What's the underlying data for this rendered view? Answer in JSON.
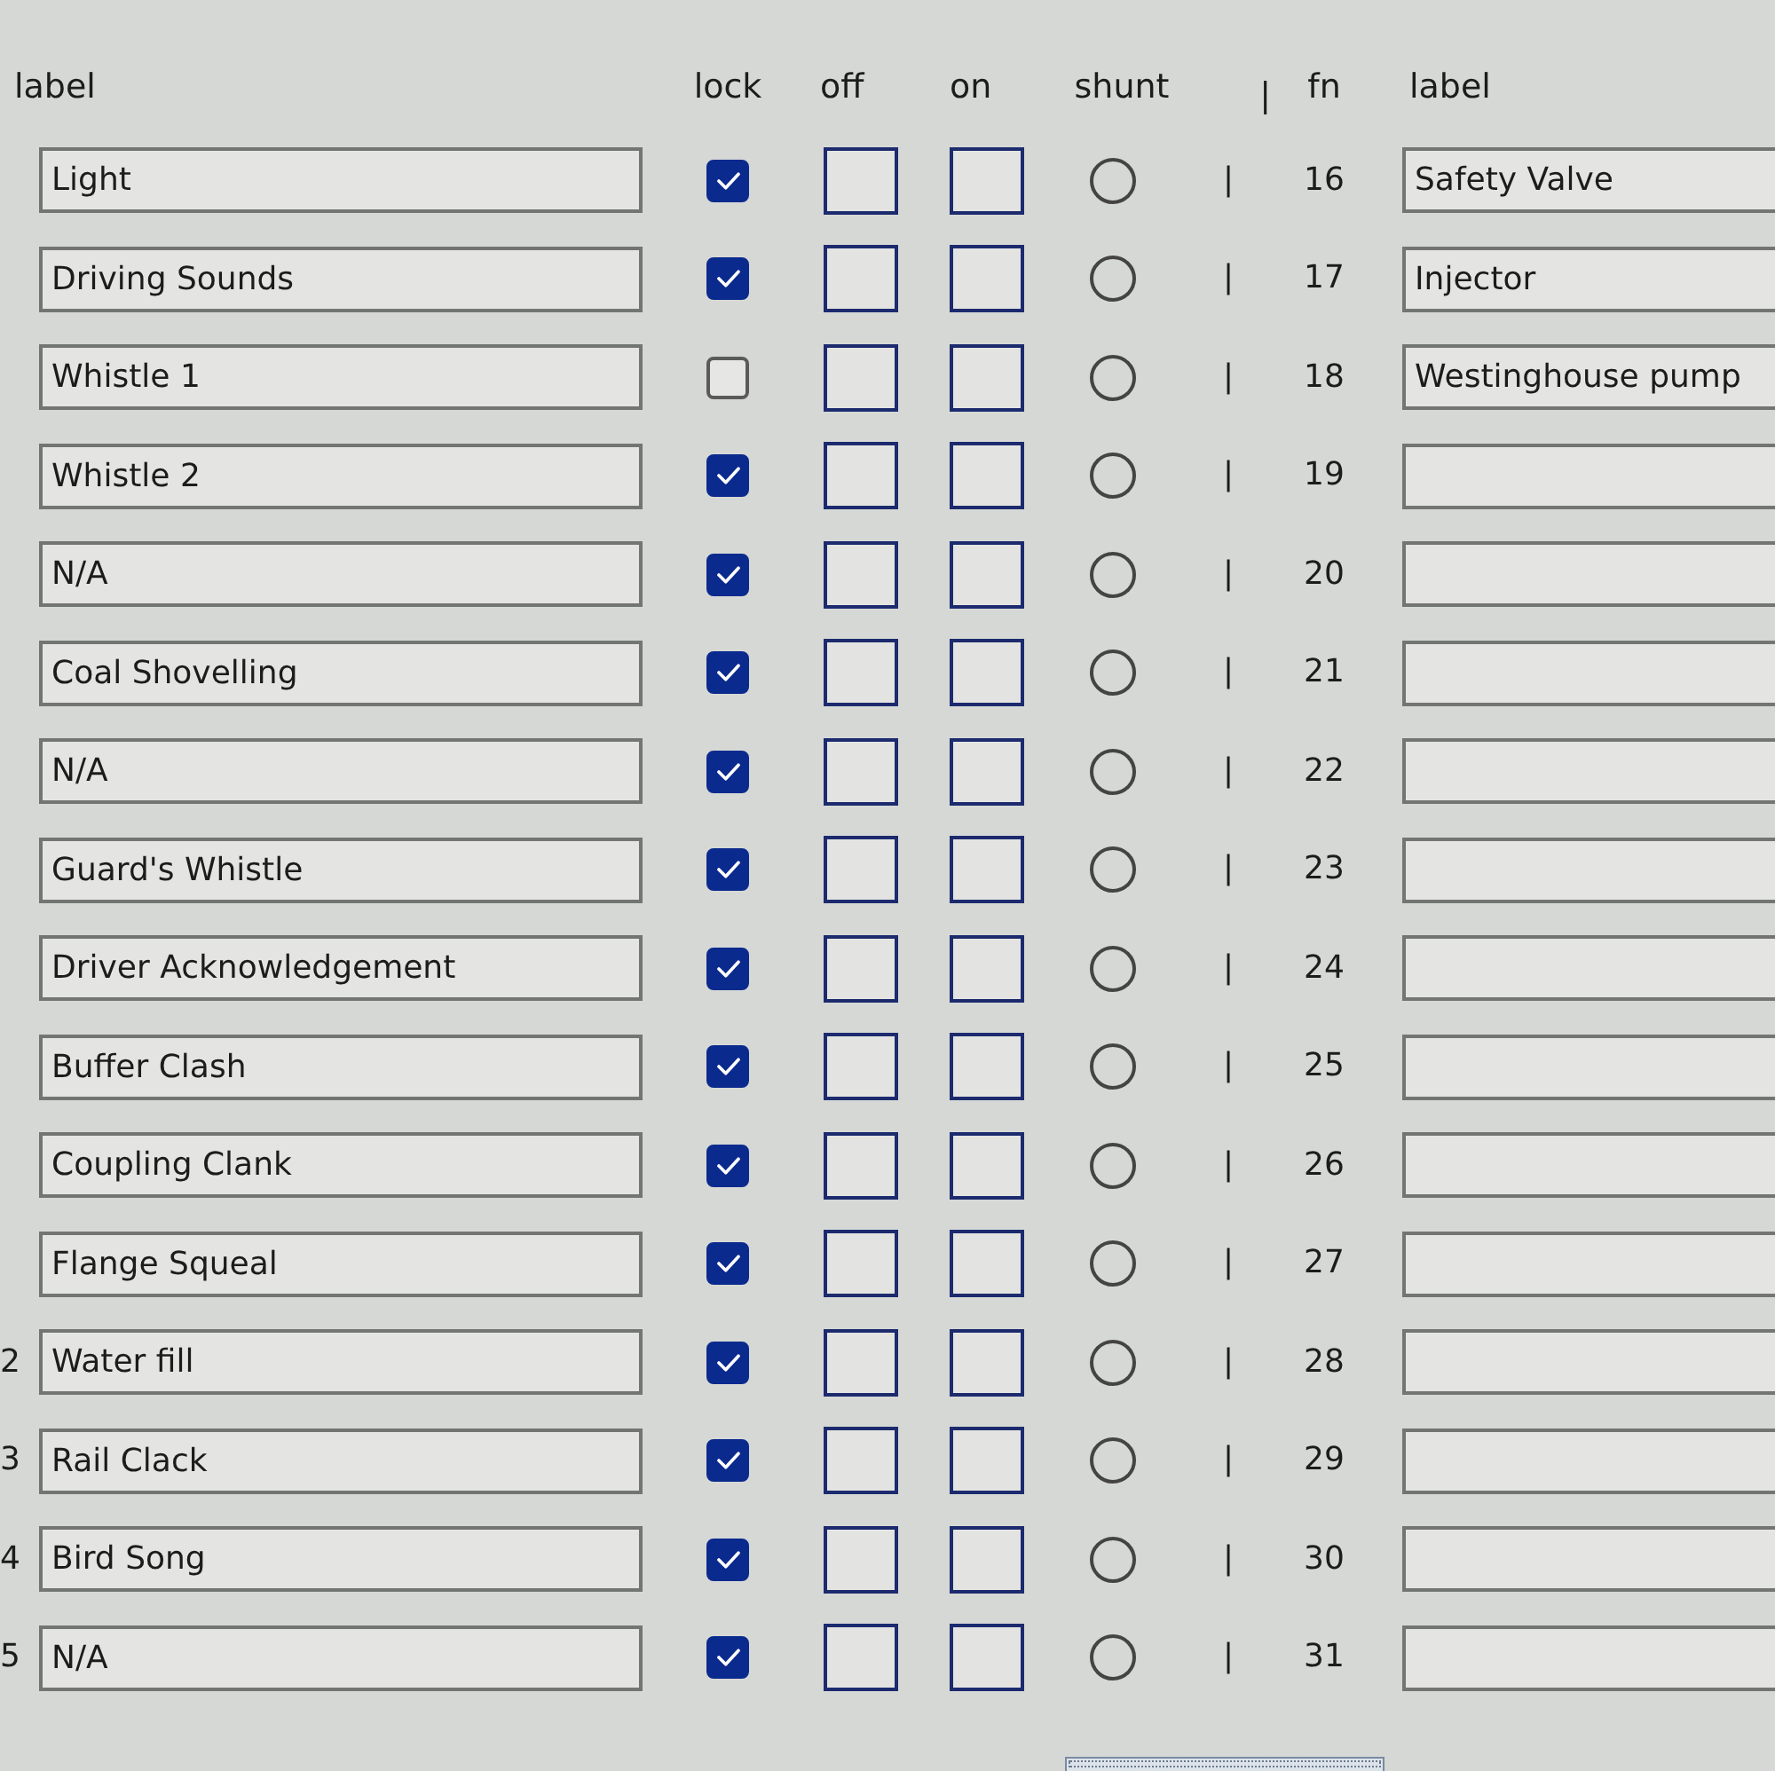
{
  "header": {
    "label": "label",
    "lock": "lock",
    "off": "off",
    "on": "on",
    "shunt": "shunt",
    "separator": "|",
    "fn": "fn",
    "fn_label": "label"
  },
  "rows": [
    {
      "label": "Light",
      "lock": {
        "checked": true
      },
      "off": {
        "checked": false
      },
      "on": {
        "checked": false
      },
      "shunt": {
        "selected": false
      },
      "separator": "|",
      "fn": "16",
      "fn_label": "Safety Valve"
    },
    {
      "label": "Driving Sounds",
      "lock": {
        "checked": true
      },
      "off": {
        "checked": false
      },
      "on": {
        "checked": false
      },
      "shunt": {
        "selected": false
      },
      "separator": "|",
      "fn": "17",
      "fn_label": "Injector"
    },
    {
      "label": "Whistle 1",
      "lock": {
        "checked": false
      },
      "off": {
        "checked": false
      },
      "on": {
        "checked": false
      },
      "shunt": {
        "selected": false
      },
      "separator": "|",
      "fn": "18",
      "fn_label": "Westinghouse pump"
    },
    {
      "label": "Whistle 2",
      "lock": {
        "checked": true
      },
      "off": {
        "checked": false
      },
      "on": {
        "checked": false
      },
      "shunt": {
        "selected": false
      },
      "separator": "|",
      "fn": "19"
    },
    {
      "label": "N/A",
      "lock": {
        "checked": true
      },
      "off": {
        "checked": false
      },
      "on": {
        "checked": false
      },
      "shunt": {
        "selected": false
      },
      "separator": "|",
      "fn": "20"
    },
    {
      "label": "Coal Shovelling",
      "lock": {
        "checked": true
      },
      "off": {
        "checked": false
      },
      "on": {
        "checked": false
      },
      "shunt": {
        "selected": false
      },
      "separator": "|",
      "fn": "21"
    },
    {
      "label": "N/A",
      "lock": {
        "checked": true
      },
      "off": {
        "checked": false
      },
      "on": {
        "checked": false
      },
      "shunt": {
        "selected": false
      },
      "separator": "|",
      "fn": "22"
    },
    {
      "label": "Guard's Whistle",
      "lock": {
        "checked": true
      },
      "off": {
        "checked": false
      },
      "on": {
        "checked": false
      },
      "shunt": {
        "selected": false
      },
      "separator": "|",
      "fn": "23"
    },
    {
      "label": "Driver Acknowledgement",
      "lock": {
        "checked": true
      },
      "off": {
        "checked": false
      },
      "on": {
        "checked": false
      },
      "shunt": {
        "selected": false
      },
      "separator": "|",
      "fn": "24"
    },
    {
      "label": "Buffer Clash",
      "lock": {
        "checked": true
      },
      "off": {
        "checked": false
      },
      "on": {
        "checked": false
      },
      "shunt": {
        "selected": false
      },
      "separator": "|",
      "fn": "25"
    },
    {
      "label": "Coupling Clank",
      "lock": {
        "checked": true
      },
      "off": {
        "checked": false
      },
      "on": {
        "checked": false
      },
      "shunt": {
        "selected": false
      },
      "separator": "|",
      "fn": "26"
    },
    {
      "label": "Flange Squeal",
      "lock": {
        "checked": true
      },
      "off": {
        "checked": false
      },
      "on": {
        "checked": false
      },
      "shunt": {
        "selected": false
      },
      "separator": "|",
      "fn": "27"
    },
    {
      "row_number": "2",
      "label": "Water fill",
      "lock": {
        "checked": true
      },
      "off": {
        "checked": false
      },
      "on": {
        "checked": false
      },
      "shunt": {
        "selected": false
      },
      "separator": "|",
      "fn": "28"
    },
    {
      "row_number": "3",
      "label": "Rail Clack",
      "lock": {
        "checked": true
      },
      "off": {
        "checked": false
      },
      "on": {
        "checked": false
      },
      "shunt": {
        "selected": false
      },
      "separator": "|",
      "fn": "29"
    },
    {
      "row_number": "4",
      "label": "Bird Song",
      "lock": {
        "checked": true
      },
      "off": {
        "checked": false
      },
      "on": {
        "checked": false
      },
      "shunt": {
        "selected": false
      },
      "separator": "|",
      "fn": "30"
    },
    {
      "row_number": "5",
      "label": "N/A",
      "lock": {
        "checked": true
      },
      "off": {
        "checked": false
      },
      "on": {
        "checked": false
      },
      "shunt": {
        "selected": false
      },
      "separator": "|",
      "fn": "31"
    }
  ]
}
